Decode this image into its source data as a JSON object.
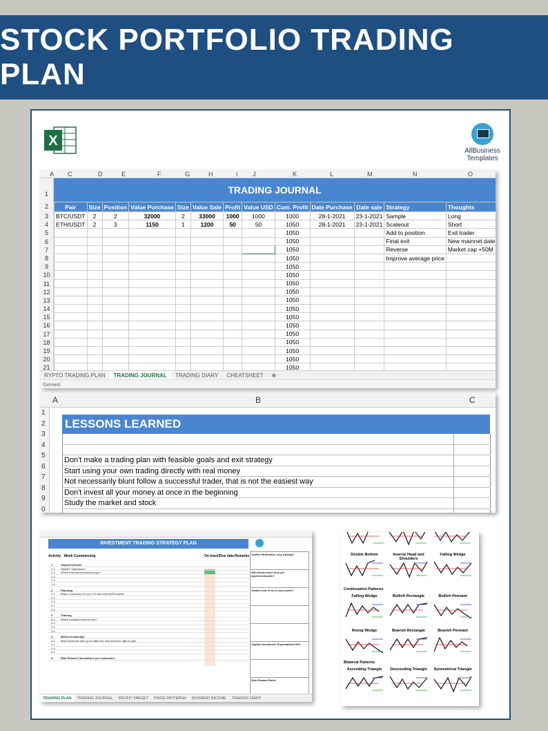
{
  "banner": {
    "title": "STOCK PORTFOLIO TRADING PLAN"
  },
  "brand": {
    "line1": "AllBusiness",
    "line2": "Templates"
  },
  "journal": {
    "title": "TRADING JOURNAL",
    "columns": [
      "A",
      "C",
      "D",
      "E",
      "F",
      "G",
      "H",
      "I",
      "J",
      "K",
      "L",
      "M",
      "N",
      "O"
    ],
    "row_numbers": [
      "1",
      "2",
      "3",
      "4",
      "5",
      "6",
      "7",
      "8",
      "9",
      "10",
      "11",
      "12",
      "13",
      "14",
      "15",
      "16",
      "17",
      "18",
      "19",
      "20",
      "21"
    ],
    "headers": [
      "Pair",
      "Size",
      "Position",
      "Value Purchase",
      "Size",
      "Value Sale",
      "Profit",
      "Value USD",
      "Cum. Profit",
      "Date Purchase",
      "Date sale",
      "Strategy",
      "Thoughts"
    ],
    "rows": [
      [
        "BTC/USDT",
        "2",
        "2",
        "32000",
        "2",
        "33000",
        "1000",
        "1000",
        "1000",
        "28-1-2021",
        "23-1-2021",
        "Sample",
        "Long"
      ],
      [
        "ETH/USDT",
        "2",
        "3",
        "1150",
        "1",
        "1200",
        "50",
        "50",
        "1050",
        "28-1-2021",
        "23-1-2021",
        "Scaleout",
        "Short"
      ],
      [
        "",
        "",
        "",
        "",
        "",
        "",
        "",
        "",
        "1050",
        "",
        "",
        "Add to position",
        "Exit trader"
      ],
      [
        "",
        "",
        "",
        "",
        "",
        "",
        "",
        "",
        "1050",
        "",
        "",
        "Final exit",
        "New mainnet date"
      ],
      [
        "",
        "",
        "",
        "",
        "",
        "",
        "",
        "",
        "1050",
        "",
        "",
        "Reverse",
        "Market cap +50M"
      ],
      [
        "",
        "",
        "",
        "",
        "",
        "",
        "",
        "",
        "1050",
        "",
        "",
        "Improve average price",
        ""
      ],
      [
        "",
        "",
        "",
        "",
        "",
        "",
        "",
        "",
        "1050",
        "",
        "",
        "",
        ""
      ],
      [
        "",
        "",
        "",
        "",
        "",
        "",
        "",
        "",
        "1050",
        "",
        "",
        "",
        ""
      ],
      [
        "",
        "",
        "",
        "",
        "",
        "",
        "",
        "",
        "1050",
        "",
        "",
        "",
        ""
      ],
      [
        "",
        "",
        "",
        "",
        "",
        "",
        "",
        "",
        "1050",
        "",
        "",
        "",
        ""
      ],
      [
        "",
        "",
        "",
        "",
        "",
        "",
        "",
        "",
        "1050",
        "",
        "",
        "",
        ""
      ],
      [
        "",
        "",
        "",
        "",
        "",
        "",
        "",
        "",
        "1050",
        "",
        "",
        "",
        ""
      ],
      [
        "",
        "",
        "",
        "",
        "",
        "",
        "",
        "",
        "1050",
        "",
        "",
        "",
        ""
      ],
      [
        "",
        "",
        "",
        "",
        "",
        "",
        "",
        "",
        "1050",
        "",
        "",
        "",
        ""
      ],
      [
        "",
        "",
        "",
        "",
        "",
        "",
        "",
        "",
        "1050",
        "",
        "",
        "",
        ""
      ],
      [
        "",
        "",
        "",
        "",
        "",
        "",
        "",
        "",
        "1050",
        "",
        "",
        "",
        ""
      ],
      [
        "",
        "",
        "",
        "",
        "",
        "",
        "",
        "",
        "1050",
        "",
        "",
        "",
        ""
      ],
      [
        "",
        "",
        "",
        "",
        "",
        "",
        "",
        "",
        "1050",
        "",
        "",
        "",
        ""
      ],
      [
        "",
        "",
        "",
        "",
        "",
        "",
        "",
        "",
        "1050",
        "",
        "",
        "",
        ""
      ]
    ],
    "tabs": [
      "RYPTO TRADING PLAN",
      "TRADING JOURNAL",
      "TRADING DIARY",
      "CHEATSHEET"
    ],
    "status": "Gereed"
  },
  "lessons": {
    "col_a": "A",
    "col_b": "B",
    "col_c": "C",
    "title": "LESSONS LEARNED",
    "row_labels": [
      "1",
      "2",
      "3",
      "4",
      "5",
      "6",
      "7",
      "8",
      "9",
      "0"
    ],
    "items": [
      "",
      "",
      "Don't make a trading plan with feasible goals and exit strategy",
      "Start using your own trading directly with real money",
      "Not necessarily blunt follow a successful trader, that is not the easiest way",
      "Don't invest all your money at once in the beginning",
      "Study the market and stock",
      ""
    ]
  },
  "strategy": {
    "title": "INVESTMENT TRADING STRATEGY PLAN",
    "col_activity": "Activity",
    "col_week": "Week Commencing",
    "col_ontrack": "On track?",
    "col_due": "Due date",
    "col_remarks": "Remarks",
    "lines": [
      {
        "num": "1",
        "text": "Objective/Goals",
        "sec": true
      },
      {
        "num": "1.1",
        "text": "SMART Objectives?",
        "sec": false
      },
      {
        "num": "1.2",
        "text": "Which instruments/shares/crypt?",
        "sec": false
      },
      {
        "num": "1.3",
        "text": "",
        "sec": false
      },
      {
        "num": "1.4",
        "text": "",
        "sec": false
      },
      {
        "num": "1.5",
        "text": "",
        "sec": false
      },
      {
        "num": "2",
        "text": "Planning",
        "sec": true
      },
      {
        "num": "2.1",
        "text": "Make a planning for top 5-10 instruments/Stocks/etc",
        "sec": false
      },
      {
        "num": "2.2",
        "text": "",
        "sec": false
      },
      {
        "num": "2.3",
        "text": "",
        "sec": false
      },
      {
        "num": "2.4",
        "text": "",
        "sec": false
      },
      {
        "num": "2.5",
        "text": "",
        "sec": false
      },
      {
        "num": "3",
        "text": "Training",
        "sec": true
      },
      {
        "num": "3.1",
        "text": "Which training is best for me?",
        "sec": false
      },
      {
        "num": "3.2",
        "text": "",
        "sec": false
      },
      {
        "num": "3.3",
        "text": "",
        "sec": false
      },
      {
        "num": "3.4",
        "text": "",
        "sec": false
      },
      {
        "num": "4",
        "text": "Market knowledge",
        "sec": true
      },
      {
        "num": "4.1",
        "text": "Best resources with up-to-date info, that proof me right in past",
        "sec": false
      },
      {
        "num": "4.2",
        "text": "",
        "sec": false
      },
      {
        "num": "4.3",
        "text": "",
        "sec": false
      },
      {
        "num": "4.4",
        "text": "",
        "sec": false
      },
      {
        "num": "5",
        "text": "Risk Reward Calculations per instrument",
        "sec": true
      }
    ],
    "right_boxes": [
      "Outline Motivation, why trading?",
      "When/how much time per day/week/month?",
      "Outline how to do it successful?",
      "",
      "",
      "Capital investment, Expectations ROI",
      "",
      "Risk Reward Ratio:"
    ],
    "tabs": [
      "TRADING PLAN",
      "TRADING JOURNAL",
      "PROFIT TARGET",
      "PRICE PATTERNS",
      "DIVIDEND INCOME",
      "TRADING DIARY"
    ]
  },
  "cheatsheet": {
    "row1": [
      "Double Bottom",
      "Inverse Head and Shoulders",
      "Falling Wedge"
    ],
    "section_continuation": "Continuation Patterns",
    "row2": [
      "Falling Wedge",
      "Bullish Rectangle",
      "Bullish Pennant"
    ],
    "row3": [
      "Rising Wedge",
      "Bearish Rectangle",
      "Bearish Pennant"
    ],
    "section_bilateral": "Bilateral Patterns",
    "row4": [
      "Ascending Triangle",
      "Descending Triangle",
      "Symmetrical Triangle"
    ]
  }
}
